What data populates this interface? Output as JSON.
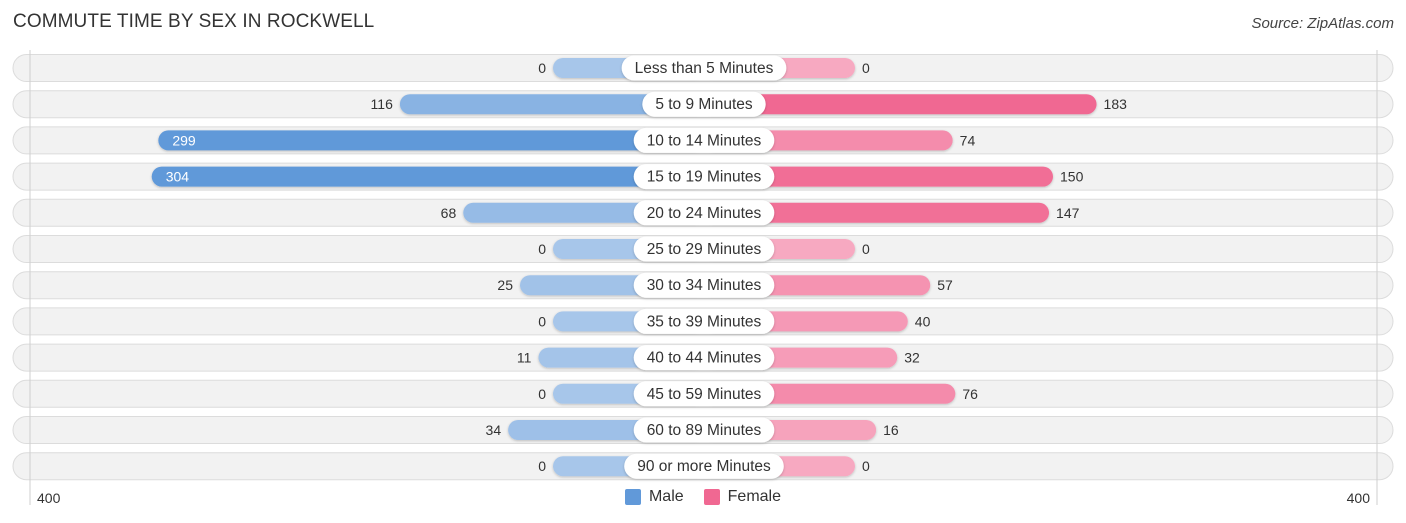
{
  "header": {
    "title": "COMMUTE TIME BY SEX IN ROCKWELL",
    "source": "Source: ZipAtlas.com"
  },
  "colors": {
    "male_strong": "#6199d9",
    "male_light": "#a7c6ea",
    "female_strong": "#f06892",
    "female_light": "#f7a9c1",
    "track": "#f2f2f2"
  },
  "chart_data": {
    "type": "bar",
    "orientation": "horizontal-diverging",
    "title": "COMMUTE TIME BY SEX IN ROCKWELL",
    "categories": [
      "Less than 5 Minutes",
      "5 to 9 Minutes",
      "10 to 14 Minutes",
      "15 to 19 Minutes",
      "20 to 24 Minutes",
      "25 to 29 Minutes",
      "30 to 34 Minutes",
      "35 to 39 Minutes",
      "40 to 44 Minutes",
      "45 to 59 Minutes",
      "60 to 89 Minutes",
      "90 or more Minutes"
    ],
    "series": [
      {
        "name": "Male",
        "values": [
          0,
          116,
          299,
          304,
          68,
          0,
          25,
          0,
          11,
          0,
          34,
          0
        ]
      },
      {
        "name": "Female",
        "values": [
          0,
          183,
          74,
          150,
          147,
          0,
          57,
          40,
          32,
          76,
          16,
          0
        ]
      }
    ],
    "axis": {
      "left_label": "400",
      "right_label": "400",
      "range": [
        0,
        400
      ]
    },
    "legend": {
      "placement": "bottom-center",
      "entries": [
        "Male",
        "Female"
      ]
    },
    "grid": false
  }
}
